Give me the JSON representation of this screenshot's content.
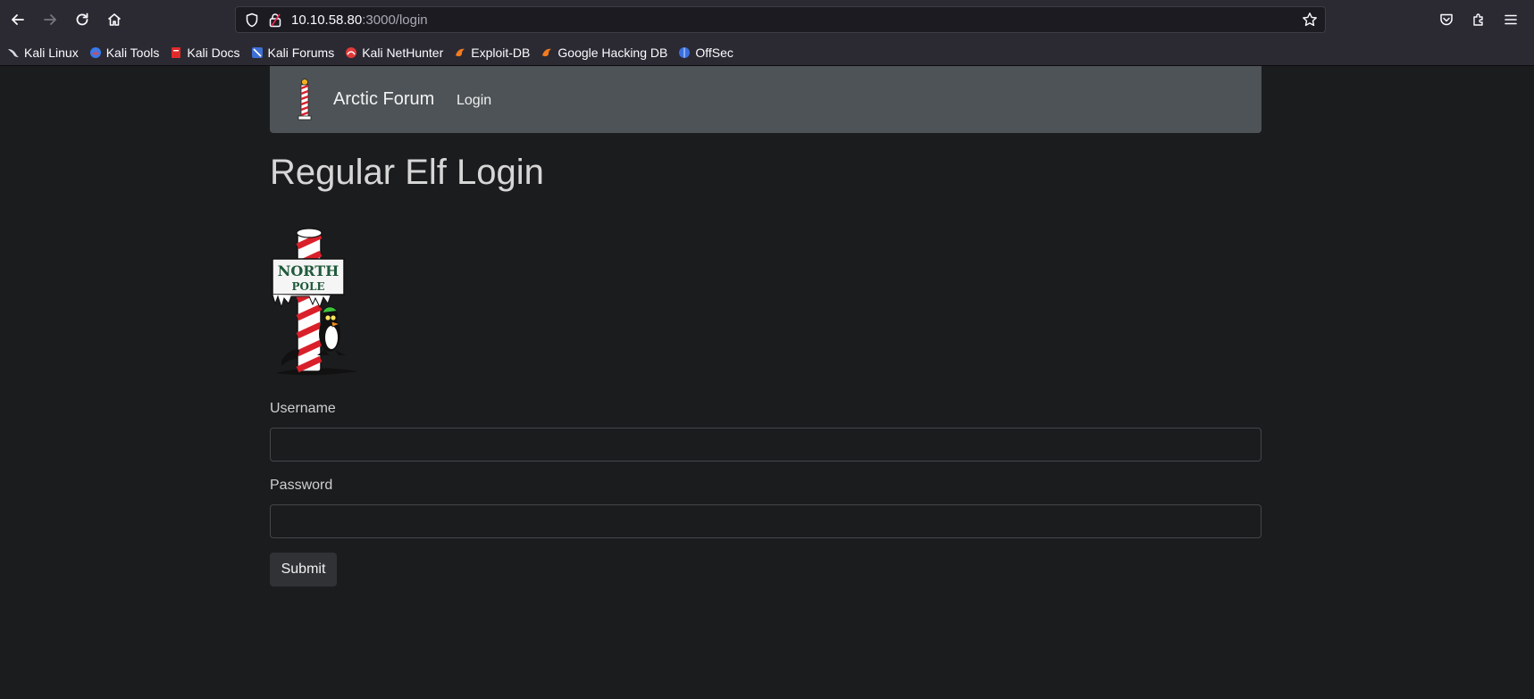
{
  "browser": {
    "url_host": "10.10.58.80",
    "url_rest": ":3000/login",
    "icons": [
      "back-icon",
      "forward-icon",
      "reload-icon",
      "home-icon",
      "shield-icon",
      "lock-icon",
      "star-icon",
      "pocket-icon",
      "extensions-icon",
      "menu-icon"
    ],
    "bookmarks": [
      {
        "label": "Kali Linux",
        "icon": "kali-dragon-icon"
      },
      {
        "label": "Kali Tools",
        "icon": "kali-tools-icon"
      },
      {
        "label": "Kali Docs",
        "icon": "kali-docs-icon"
      },
      {
        "label": "Kali Forums",
        "icon": "kali-forums-icon"
      },
      {
        "label": "Kali NetHunter",
        "icon": "nethunter-icon"
      },
      {
        "label": "Exploit-DB",
        "icon": "exploitdb-icon"
      },
      {
        "label": "Google Hacking DB",
        "icon": "ghdb-icon"
      },
      {
        "label": "OffSec",
        "icon": "offsec-icon"
      }
    ]
  },
  "site": {
    "brand": "Arctic Forum",
    "nav_login": "Login"
  },
  "page": {
    "title": "Regular Elf Login",
    "sign_line1": "NORTH",
    "sign_line2": "POLE",
    "username_label": "Username",
    "username_value": "",
    "password_label": "Password",
    "password_value": "",
    "submit_label": "Submit"
  },
  "colors": {
    "page_bg": "#1b1c1e",
    "nav_bg": "#4e5357",
    "chrome_bg": "#2b2a33",
    "pole_red": "#d9202a"
  }
}
